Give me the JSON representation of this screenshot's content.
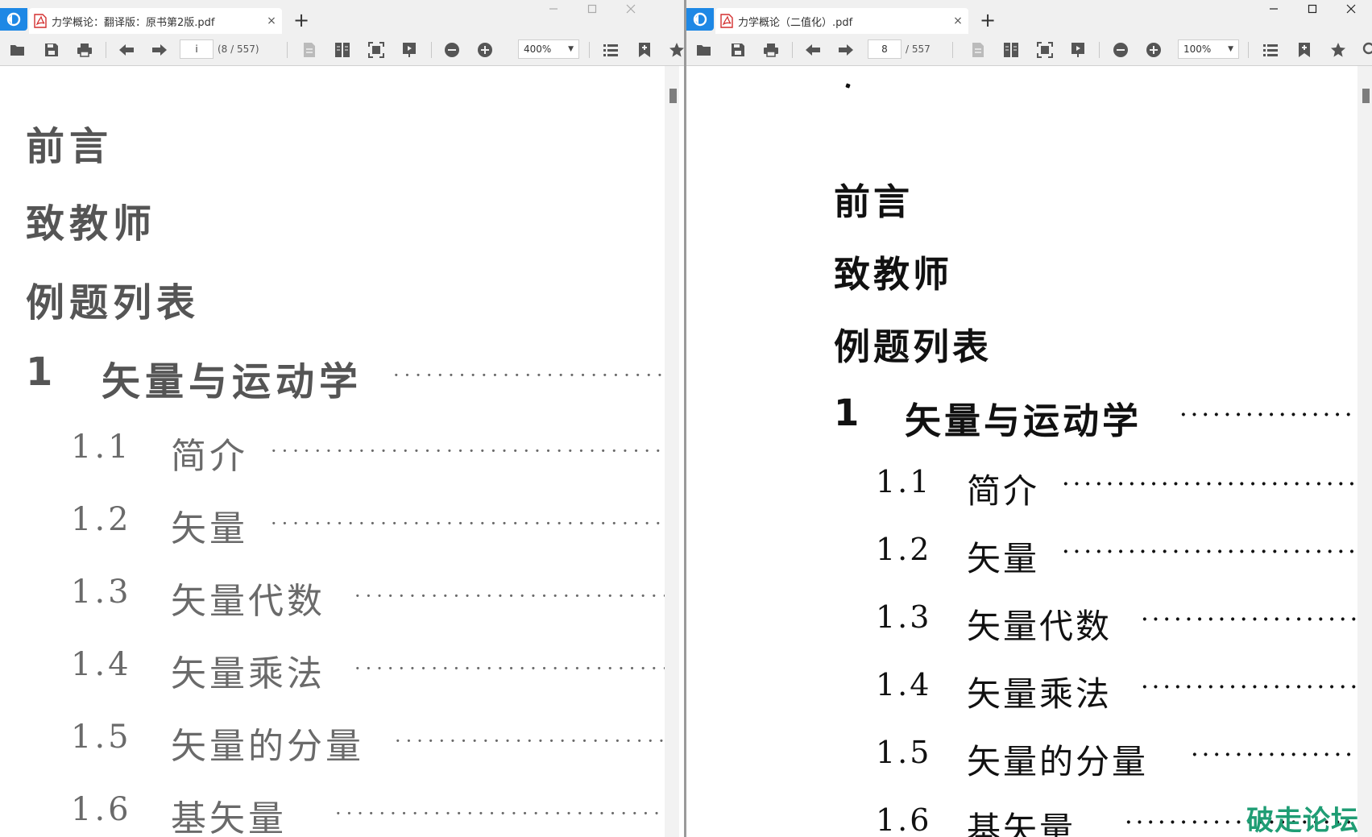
{
  "colors": {
    "accent": "#1e88e5",
    "pdf_red": "#d32f2f",
    "watermark": "#1f9d74"
  },
  "left_window": {
    "tab_title": "力学概论：翻译版：原书第2版.pdf",
    "tab_close": "×",
    "new_tab": "+",
    "page_value": "i",
    "page_count": "(8 / 557)",
    "zoom": "400%",
    "toc": {
      "preface": "前言",
      "to_teacher": "致教师",
      "examples": "例题列表",
      "chapter1": {
        "num": "1",
        "title": "矢量与运动学"
      },
      "sections": [
        {
          "num": "1.1",
          "title": "简介"
        },
        {
          "num": "1.2",
          "title": "矢量"
        },
        {
          "num": "1.3",
          "title": "矢量代数"
        },
        {
          "num": "1.4",
          "title": "矢量乘法"
        },
        {
          "num": "1.5",
          "title": "矢量的分量"
        },
        {
          "num": "1.6",
          "title": "基矢量"
        }
      ]
    }
  },
  "right_window": {
    "tab_title": "力学概论（二值化）.pdf",
    "tab_close": "×",
    "new_tab": "+",
    "page_value": "8",
    "page_count": "/ 557",
    "zoom": "100%",
    "toc": {
      "preface": "前言",
      "to_teacher": "致教师",
      "examples": "例题列表",
      "chapter1": {
        "num": "1",
        "title": "矢量与运动学"
      },
      "sections": [
        {
          "num": "1.1",
          "title": "简介"
        },
        {
          "num": "1.2",
          "title": "矢量"
        },
        {
          "num": "1.3",
          "title": "矢量代数"
        },
        {
          "num": "1.4",
          "title": "矢量乘法"
        },
        {
          "num": "1.5",
          "title": "矢量的分量"
        },
        {
          "num": "1.6",
          "title": "基矢量"
        }
      ]
    }
  },
  "toc_leader": "·······································",
  "watermark": "破走论坛",
  "icons": [
    "app-logo-icon",
    "pdf-file-icon",
    "open-folder-icon",
    "save-icon",
    "print-icon",
    "arrow-left-icon",
    "arrow-right-icon",
    "single-page-icon",
    "two-page-icon",
    "fit-page-icon",
    "slideshow-icon",
    "zoom-out-icon",
    "zoom-in-icon",
    "outline-list-icon",
    "bookmark-add-icon",
    "star-icon",
    "search-icon",
    "minimize-icon",
    "maximize-icon",
    "close-icon"
  ]
}
